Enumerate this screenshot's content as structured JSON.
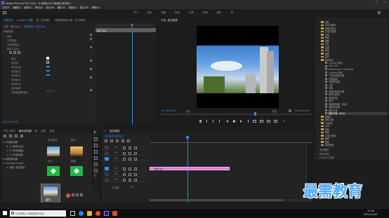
{
  "app": {
    "title": "Adobe Premiere Pro 2020 - D:\\视频\\0007\\静组剪 素材库 *",
    "menu": [
      "文件(F)",
      "编辑(E)",
      "剪辑(C)",
      "序列(S)",
      "标记(M)",
      "图形(G)",
      "视图(V)",
      "窗口(W)",
      "帮助(H)"
    ],
    "workspaces": [
      "学习",
      "组件",
      "编辑",
      "颜色",
      "效果",
      "音频",
      "图形",
      "库"
    ],
    "active_workspace": "效果",
    "window_controls": {
      "minimize": "—",
      "maximize": "□",
      "close": "✕"
    }
  },
  "effect_controls": {
    "tabs": [
      "效果控件",
      "Lumetri 范围",
      "源（无剪辑）",
      "音频剪辑混合器：皮光照夏"
    ],
    "master": "主要 * 星光.jpg",
    "sequence": "皮光照夏 * 星光.jpg",
    "section_video": "视频效果",
    "items": [
      "运动",
      "不透明度",
      "时间重映射",
      "颜色 (高光)"
    ],
    "sub_items": [
      "颜色",
      "渐变色",
      "渐变色度",
      "渐变起点",
      "渐变终点",
      "渐变起点",
      "渐变终点",
      "高光偏移",
      "与原始图像混合"
    ],
    "values": [
      "",
      "",
      "",
      "",
      "",
      "",
      "",
      "",
      "0.0 %"
    ],
    "clip_label": "星光.jpg",
    "timecode": "00:00:03:03"
  },
  "program_monitor": {
    "tab": "节目: 皮光照夏",
    "timecode_left": "00:00:03:03",
    "fit": "适合",
    "quality": "完整",
    "timecode_right": "00:00:03:03"
  },
  "project_panel": {
    "tabs": [
      "项目: 素材",
      "媒体浏览器",
      "库",
      "信息",
      "效果"
    ],
    "sidebar": [
      "本地驱动器",
      "C (系统分区)",
      "D (本地磁盘)",
      "E (本地磁盘)",
      "网络驱动器",
      "Creative Cloud",
      "团队 项目版本"
    ],
    "thumbs": [
      "皮光照夏",
      "星光",
      "四分",
      "视频"
    ],
    "selected_thumb": "星光"
  },
  "timeline": {
    "tab": "皮光照夏",
    "timecode": "00:00:03:03",
    "video_tracks": [
      "V3",
      "V2",
      "V1"
    ],
    "audio_tracks": [
      "A1",
      "A2",
      "A3"
    ],
    "master": "主声道",
    "master_value": "0.0",
    "clip": "星光.jpg"
  },
  "effects_panel": {
    "items": [
      "扭曲",
      "杂色与颗粒",
      "模糊与锐化",
      "沉浸式视频",
      "生成",
      "视频",
      "调整",
      "过时",
      "过渡",
      "透视",
      "通道",
      "键控",
      "颜色校正",
      "Lumetri 颜色",
      "ASC CDL",
      "Brightness & Contrast",
      "Lumetri 颜色",
      "三向颜色校正器",
      "亮度曲线",
      "亮度校正器",
      "分色",
      "均衡",
      "快速颜色校正器",
      "更改为颜色",
      "更改颜色",
      "色彩",
      "视频限幅器（旧版）",
      "通道混合器",
      "颜色平衡",
      "颜色平衡（HLS）",
      "风格化",
      "视频过渡",
      "3D运动",
      "内滑",
      "划像",
      "擦除",
      "沉浸式视频",
      "溶解",
      "缩放",
      "页面剥落"
    ],
    "selected": "颜色平衡（HLS）",
    "bottom": [
      "基本图形",
      "基本声音",
      "Lumetri 颜色",
      "库",
      "标记",
      "历史记录",
      "信息"
    ]
  },
  "watermark": "最需教育",
  "taskbar": {
    "search": "在这里输入你要搜索的内容",
    "time": "11:16",
    "date": "2021/11/25"
  },
  "colors": {
    "accent": "#2d8ceb",
    "bg": "#232323",
    "clip": "#e07ad6",
    "folder": "#c8a448",
    "playhead": "#2d8ceb"
  }
}
